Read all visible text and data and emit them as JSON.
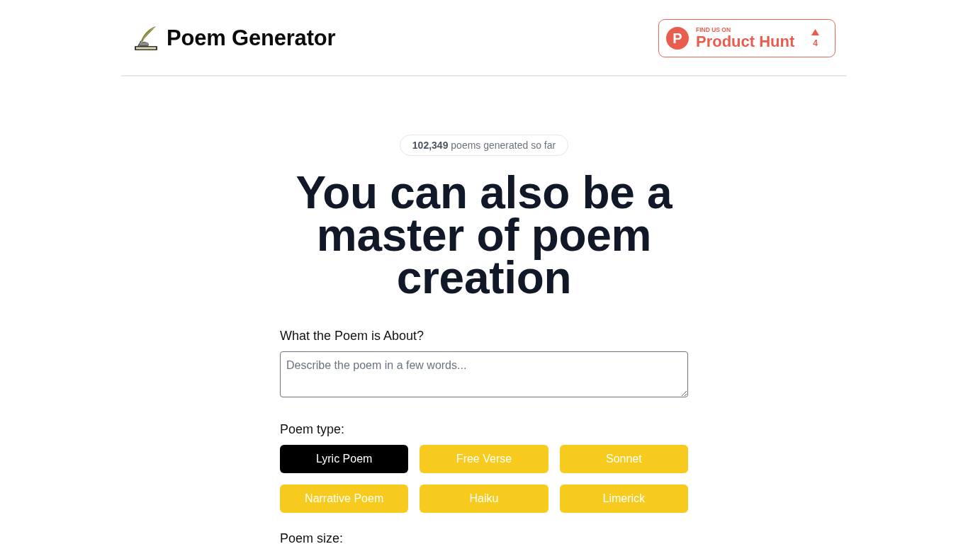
{
  "header": {
    "title": "Poem Generator",
    "product_hunt": {
      "logo_letter": "P",
      "tagline": "FIND US ON",
      "name": "Product Hunt",
      "upvotes": "4"
    }
  },
  "hero": {
    "counter": "**102,349** poems generated so far",
    "heading": "You can also be a master of poem creation"
  },
  "form": {
    "about": {
      "label": "What the Poem is About?",
      "placeholder": "Describe the poem in a few words..."
    },
    "poem_type": {
      "label": "Poem type:",
      "options": [
        {
          "label": "Lyric Poem",
          "selected": true
        },
        {
          "label": "Free Verse",
          "selected": false
        },
        {
          "label": "Sonnet",
          "selected": false
        },
        {
          "label": "Narrative Poem",
          "selected": false
        },
        {
          "label": "Haiku",
          "selected": false
        },
        {
          "label": "Limerick",
          "selected": false
        }
      ]
    },
    "poem_size": {
      "label": "Poem size:"
    }
  }
}
